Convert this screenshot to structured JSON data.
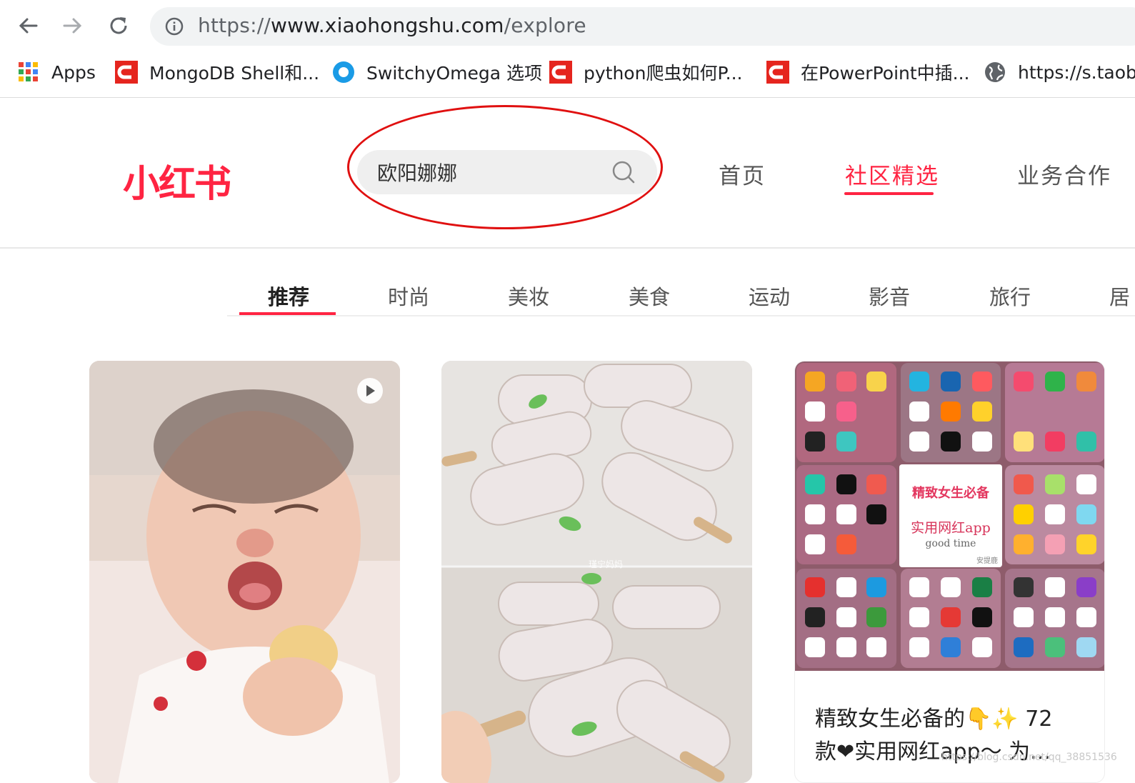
{
  "browser": {
    "url_scheme": "https://",
    "url_host": "www.xiaohongshu.com",
    "url_path": "/explore",
    "bookmarks": [
      {
        "label": "Apps",
        "icon": "apps-grid-icon"
      },
      {
        "label": "MongoDB Shell和...",
        "icon": "csdn-icon"
      },
      {
        "label": "SwitchyOmega 选项",
        "icon": "switchyomega-icon"
      },
      {
        "label": "python爬虫如何P...",
        "icon": "csdn-icon"
      },
      {
        "label": "在PowerPoint中插...",
        "icon": "csdn-icon"
      },
      {
        "label": "https://s.taob",
        "icon": "globe-icon"
      }
    ]
  },
  "site": {
    "logo": "小红书",
    "search_value": "欧阳娜娜",
    "nav": [
      {
        "label": "首页",
        "active": false
      },
      {
        "label": "社区精选",
        "active": true
      },
      {
        "label": "业务合作",
        "active": false
      }
    ],
    "brand_color": "#ff2442"
  },
  "categories": [
    {
      "label": "推荐",
      "active": true
    },
    {
      "label": "时尚",
      "active": false
    },
    {
      "label": "美妆",
      "active": false
    },
    {
      "label": "美食",
      "active": false
    },
    {
      "label": "运动",
      "active": false
    },
    {
      "label": "影音",
      "active": false
    },
    {
      "label": "旅行",
      "active": false
    },
    {
      "label": "居",
      "active": false
    }
  ],
  "feed": {
    "cards": [
      {
        "kind": "video",
        "image": "crying-baby-photo"
      },
      {
        "kind": "image",
        "image": "popsicle-photo",
        "overlay": "瑾宁妈妈"
      },
      {
        "kind": "image",
        "image": "app-collage",
        "panel_title": "精致女生必备",
        "panel_sub": "实用网红app",
        "panel_tag": "good time",
        "panel_author": "安提鹿",
        "title_line1": "精致女生必备的👇✨ 72",
        "title_line2": "款❤实用网红app～ 为..."
      }
    ]
  },
  "watermark": "https://blog.csdn.net/qq_38851536",
  "annotation_color": "#e01010"
}
